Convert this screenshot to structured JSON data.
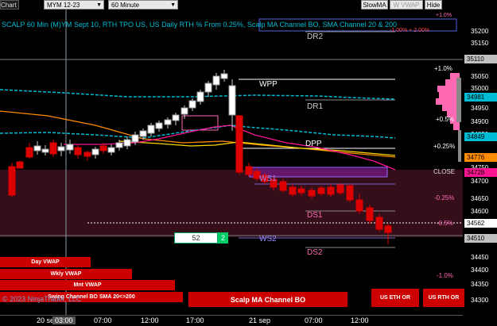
{
  "toolbar": {
    "chart_label": "Chart",
    "instrument": "MYM 12-23",
    "interval": "60 Minute",
    "slow_ma": "SlowMA",
    "w_vwap": "W VWAP",
    "hide": "Hide"
  },
  "header": {
    "title": "SCALP 60 Min (M)YM Sept 10, RTH TPO US, US Daily RTH % From 0.25%, Scalp MA Channel BO, SMA Channel 20 & 200"
  },
  "price_axis": {
    "ticks": [
      "35200",
      "35150",
      "35050",
      "35000",
      "34950",
      "34900",
      "34850",
      "34750",
      "34700",
      "34650",
      "34600",
      "34550",
      "34450",
      "34400",
      "34350",
      "34300"
    ],
    "tags": [
      {
        "label": "35110",
        "bg": "#c0c0c0",
        "fg": "#000000"
      },
      {
        "label": "34981",
        "bg": "#00bcd4",
        "fg": "#000000"
      },
      {
        "label": "34849",
        "bg": "#00bcd4",
        "fg": "#000000"
      },
      {
        "label": "34776",
        "bg": "#ff8c00",
        "fg": "#000000"
      },
      {
        "label": "34728",
        "bg": "#ff1493",
        "fg": "#000000"
      },
      {
        "label": "34562",
        "bg": "#ffffff",
        "fg": "#000000"
      },
      {
        "label": "34510",
        "bg": "#c0c0c0",
        "fg": "#000000"
      }
    ]
  },
  "levels": {
    "dr2": "DR2",
    "wpp": "WPP",
    "dr1": "DR1",
    "dpp": "DPP",
    "ws1": "WS1",
    "ds1": "DS1",
    "ws2": "WS2",
    "ds2": "DS2"
  },
  "percent_labels": {
    "p1_0": "+1.0%",
    "p0_5": "+0.5%",
    "p0_25": "+0.25%",
    "close": "CLOSE",
    "m0_25": "-0.25%",
    "m0_5": "-0.5%",
    "m1_0": "-1.0%",
    "top_partial": "+1.0%",
    "top_right_partial": "-1.00% + 2.00%"
  },
  "volume_box": {
    "value": "52",
    "count": "2"
  },
  "buttons": {
    "day_vwap": "Day VWAP",
    "wkly_vwap": "Wkly VWAP",
    "mnt_vwap": "Mnt VWAP",
    "swing_channel": "Swing Channel BO SMA 20<>200",
    "scalp_channel": "Scalp MA Channel BO",
    "us_eth_or": "US ETH OR",
    "us_rth_or": "US RTH OR"
  },
  "copyright": "© 2023 NinjaTrader, LLC",
  "time_axis": {
    "labels": [
      "20 se",
      "03:00",
      "07:00",
      "12:00",
      "17:00",
      "21 sep",
      "07:00",
      "12:00"
    ]
  },
  "colors": {
    "up_candle": "#ffffff",
    "down_candle": "#dd0000",
    "sma20": "#ff8c00",
    "sma200": "#ff1493",
    "cyan_channel": "#00bcd4",
    "yellow_line": "#ffd700"
  }
}
